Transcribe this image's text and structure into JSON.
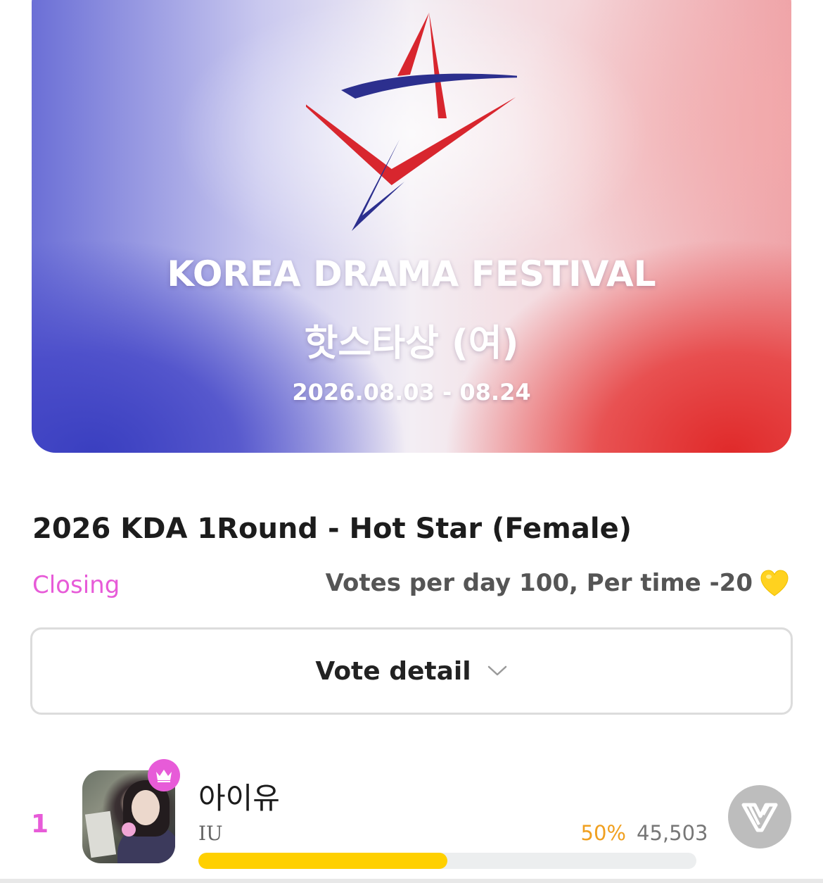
{
  "banner": {
    "title": "KOREA DRAMA FESTIVAL",
    "subtitle": "핫스타상 (여)",
    "dates": "2026.08.03 - 08.24"
  },
  "vote": {
    "title": "2026 KDA 1Round - Hot Star (Female)",
    "status": "Closing",
    "votes_info": "Votes per day 100,  Per time -20",
    "detail_label": "Vote detail"
  },
  "candidates": [
    {
      "rank": "1",
      "name_ko": "아이유",
      "name_en": "IU",
      "percent_label": "50%",
      "percent": 0.5,
      "count": "45,503"
    }
  ],
  "colors": {
    "accent_pink": "#e75bd8",
    "percent_orange": "#f0a020",
    "bar_yellow": "#ffd000",
    "vote_button_gray": "#bdbdbd"
  },
  "icons": {
    "heart": "yellow-heart-icon",
    "chevron": "chevron-down-icon",
    "crown": "crown-icon",
    "vote": "vote-logo-icon"
  }
}
